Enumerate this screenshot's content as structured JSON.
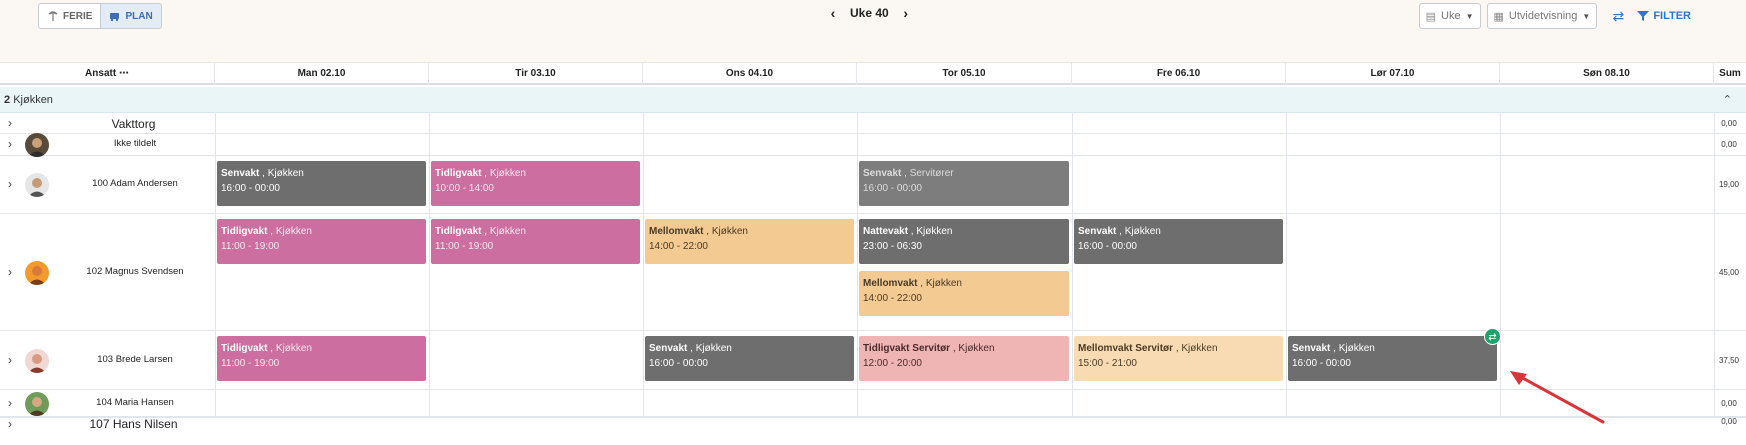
{
  "toolbar": {
    "ferie_label": "FERIE",
    "plan_label": "PLAN",
    "week_label": "Uke 40",
    "period_select": "Uke",
    "view_select": "Utvidetvisning",
    "filter_label": "FILTER"
  },
  "header": {
    "employee_col": "Ansatt",
    "more": "⋯",
    "days": [
      "Man 02.10",
      "Tir 03.10",
      "Ons 04.10",
      "Tor 05.10",
      "Fre 06.10",
      "Lør 07.10",
      "Søn 08.10"
    ],
    "sum_col": "Sum"
  },
  "group": {
    "count": "2",
    "name": "Kjøkken"
  },
  "rows": [
    {
      "name": "Vakttorg",
      "sum": "0,00"
    },
    {
      "name": "Ikke tildelt",
      "sum": "0,00"
    },
    {
      "name": "100 Adam Andersen",
      "sum": "19,00"
    },
    {
      "name": "102 Magnus Svendsen",
      "sum": "45,00"
    },
    {
      "name": "103 Brede Larsen",
      "sum": "37,50"
    },
    {
      "name": "104 Maria Hansen",
      "sum": "0,00"
    },
    {
      "name": "107 Hans Nilsen",
      "sum": "0,00"
    }
  ],
  "shifts": [
    {
      "row": 2,
      "day": 0,
      "title": "Senvakt",
      "location": "Kjøkken",
      "time": "16:00 - 00:00"
    },
    {
      "row": 2,
      "day": 1,
      "title": "Tidligvakt",
      "location": "Kjøkken",
      "time": "10:00 - 14:00"
    },
    {
      "row": 2,
      "day": 3,
      "title": "Senvakt",
      "location": "Servitører",
      "time": "16:00 - 00:00"
    },
    {
      "row": 3,
      "day": 0,
      "title": "Tidligvakt",
      "location": "Kjøkken",
      "time": "11:00 - 19:00"
    },
    {
      "row": 3,
      "day": 1,
      "title": "Tidligvakt",
      "location": "Kjøkken",
      "time": "11:00 - 19:00"
    },
    {
      "row": 3,
      "day": 2,
      "title": "Mellomvakt",
      "location": "Kjøkken",
      "time": "14:00 - 22:00"
    },
    {
      "row": 3,
      "day": 3,
      "title": "Nattevakt",
      "location": "Kjøkken",
      "time": "23:00 - 06:30"
    },
    {
      "row": 3,
      "day": 3,
      "title": "Mellomvakt",
      "location": "Kjøkken",
      "time": "14:00 - 22:00"
    },
    {
      "row": 3,
      "day": 4,
      "title": "Senvakt",
      "location": "Kjøkken",
      "time": "16:00 - 00:00"
    },
    {
      "row": 4,
      "day": 0,
      "title": "Tidligvakt",
      "location": "Kjøkken",
      "time": "11:00 - 19:00"
    },
    {
      "row": 4,
      "day": 2,
      "title": "Senvakt",
      "location": "Kjøkken",
      "time": "16:00 - 00:00"
    },
    {
      "row": 4,
      "day": 3,
      "title": "Tidligvakt Servitør",
      "location": "Kjøkken",
      "time": "12:00 - 20:00"
    },
    {
      "row": 4,
      "day": 4,
      "title": "Mellomvakt Servitør",
      "location": "Kjøkken",
      "time": "15:00 - 21:00"
    },
    {
      "row": 4,
      "day": 5,
      "title": "Senvakt",
      "location": "Kjøkken",
      "time": "16:00 - 00:00"
    }
  ],
  "colors": {
    "dark": "#6e6e6e",
    "pink": "#cc6e9f",
    "orange": "#f4ca93",
    "salmon": "#efb5b5",
    "peach": "#f8dbb3",
    "accent": "#2f73d0",
    "swap_badge": "#1fa36a",
    "annotation_arrow": "#d9343a"
  },
  "icons": [
    "ferie-icon",
    "plan-icon",
    "chevron-left-icon",
    "chevron-right-icon",
    "calendar-icon",
    "grid-icon",
    "shuffle-icon",
    "filter-icon",
    "swap-icon"
  ]
}
